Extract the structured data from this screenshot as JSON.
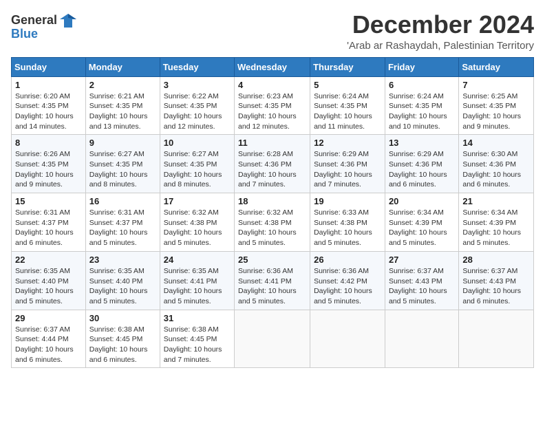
{
  "header": {
    "logo_general": "General",
    "logo_blue": "Blue",
    "month_title": "December 2024",
    "location": "'Arab ar Rashaydah, Palestinian Territory"
  },
  "days_of_week": [
    "Sunday",
    "Monday",
    "Tuesday",
    "Wednesday",
    "Thursday",
    "Friday",
    "Saturday"
  ],
  "weeks": [
    [
      {
        "day": "1",
        "sunrise": "Sunrise: 6:20 AM",
        "sunset": "Sunset: 4:35 PM",
        "daylight": "Daylight: 10 hours and 14 minutes."
      },
      {
        "day": "2",
        "sunrise": "Sunrise: 6:21 AM",
        "sunset": "Sunset: 4:35 PM",
        "daylight": "Daylight: 10 hours and 13 minutes."
      },
      {
        "day": "3",
        "sunrise": "Sunrise: 6:22 AM",
        "sunset": "Sunset: 4:35 PM",
        "daylight": "Daylight: 10 hours and 12 minutes."
      },
      {
        "day": "4",
        "sunrise": "Sunrise: 6:23 AM",
        "sunset": "Sunset: 4:35 PM",
        "daylight": "Daylight: 10 hours and 12 minutes."
      },
      {
        "day": "5",
        "sunrise": "Sunrise: 6:24 AM",
        "sunset": "Sunset: 4:35 PM",
        "daylight": "Daylight: 10 hours and 11 minutes."
      },
      {
        "day": "6",
        "sunrise": "Sunrise: 6:24 AM",
        "sunset": "Sunset: 4:35 PM",
        "daylight": "Daylight: 10 hours and 10 minutes."
      },
      {
        "day": "7",
        "sunrise": "Sunrise: 6:25 AM",
        "sunset": "Sunset: 4:35 PM",
        "daylight": "Daylight: 10 hours and 9 minutes."
      }
    ],
    [
      {
        "day": "8",
        "sunrise": "Sunrise: 6:26 AM",
        "sunset": "Sunset: 4:35 PM",
        "daylight": "Daylight: 10 hours and 9 minutes."
      },
      {
        "day": "9",
        "sunrise": "Sunrise: 6:27 AM",
        "sunset": "Sunset: 4:35 PM",
        "daylight": "Daylight: 10 hours and 8 minutes."
      },
      {
        "day": "10",
        "sunrise": "Sunrise: 6:27 AM",
        "sunset": "Sunset: 4:35 PM",
        "daylight": "Daylight: 10 hours and 8 minutes."
      },
      {
        "day": "11",
        "sunrise": "Sunrise: 6:28 AM",
        "sunset": "Sunset: 4:36 PM",
        "daylight": "Daylight: 10 hours and 7 minutes."
      },
      {
        "day": "12",
        "sunrise": "Sunrise: 6:29 AM",
        "sunset": "Sunset: 4:36 PM",
        "daylight": "Daylight: 10 hours and 7 minutes."
      },
      {
        "day": "13",
        "sunrise": "Sunrise: 6:29 AM",
        "sunset": "Sunset: 4:36 PM",
        "daylight": "Daylight: 10 hours and 6 minutes."
      },
      {
        "day": "14",
        "sunrise": "Sunrise: 6:30 AM",
        "sunset": "Sunset: 4:36 PM",
        "daylight": "Daylight: 10 hours and 6 minutes."
      }
    ],
    [
      {
        "day": "15",
        "sunrise": "Sunrise: 6:31 AM",
        "sunset": "Sunset: 4:37 PM",
        "daylight": "Daylight: 10 hours and 6 minutes."
      },
      {
        "day": "16",
        "sunrise": "Sunrise: 6:31 AM",
        "sunset": "Sunset: 4:37 PM",
        "daylight": "Daylight: 10 hours and 5 minutes."
      },
      {
        "day": "17",
        "sunrise": "Sunrise: 6:32 AM",
        "sunset": "Sunset: 4:38 PM",
        "daylight": "Daylight: 10 hours and 5 minutes."
      },
      {
        "day": "18",
        "sunrise": "Sunrise: 6:32 AM",
        "sunset": "Sunset: 4:38 PM",
        "daylight": "Daylight: 10 hours and 5 minutes."
      },
      {
        "day": "19",
        "sunrise": "Sunrise: 6:33 AM",
        "sunset": "Sunset: 4:38 PM",
        "daylight": "Daylight: 10 hours and 5 minutes."
      },
      {
        "day": "20",
        "sunrise": "Sunrise: 6:34 AM",
        "sunset": "Sunset: 4:39 PM",
        "daylight": "Daylight: 10 hours and 5 minutes."
      },
      {
        "day": "21",
        "sunrise": "Sunrise: 6:34 AM",
        "sunset": "Sunset: 4:39 PM",
        "daylight": "Daylight: 10 hours and 5 minutes."
      }
    ],
    [
      {
        "day": "22",
        "sunrise": "Sunrise: 6:35 AM",
        "sunset": "Sunset: 4:40 PM",
        "daylight": "Daylight: 10 hours and 5 minutes."
      },
      {
        "day": "23",
        "sunrise": "Sunrise: 6:35 AM",
        "sunset": "Sunset: 4:40 PM",
        "daylight": "Daylight: 10 hours and 5 minutes."
      },
      {
        "day": "24",
        "sunrise": "Sunrise: 6:35 AM",
        "sunset": "Sunset: 4:41 PM",
        "daylight": "Daylight: 10 hours and 5 minutes."
      },
      {
        "day": "25",
        "sunrise": "Sunrise: 6:36 AM",
        "sunset": "Sunset: 4:41 PM",
        "daylight": "Daylight: 10 hours and 5 minutes."
      },
      {
        "day": "26",
        "sunrise": "Sunrise: 6:36 AM",
        "sunset": "Sunset: 4:42 PM",
        "daylight": "Daylight: 10 hours and 5 minutes."
      },
      {
        "day": "27",
        "sunrise": "Sunrise: 6:37 AM",
        "sunset": "Sunset: 4:43 PM",
        "daylight": "Daylight: 10 hours and 5 minutes."
      },
      {
        "day": "28",
        "sunrise": "Sunrise: 6:37 AM",
        "sunset": "Sunset: 4:43 PM",
        "daylight": "Daylight: 10 hours and 6 minutes."
      }
    ],
    [
      {
        "day": "29",
        "sunrise": "Sunrise: 6:37 AM",
        "sunset": "Sunset: 4:44 PM",
        "daylight": "Daylight: 10 hours and 6 minutes."
      },
      {
        "day": "30",
        "sunrise": "Sunrise: 6:38 AM",
        "sunset": "Sunset: 4:45 PM",
        "daylight": "Daylight: 10 hours and 6 minutes."
      },
      {
        "day": "31",
        "sunrise": "Sunrise: 6:38 AM",
        "sunset": "Sunset: 4:45 PM",
        "daylight": "Daylight: 10 hours and 7 minutes."
      },
      null,
      null,
      null,
      null
    ]
  ]
}
